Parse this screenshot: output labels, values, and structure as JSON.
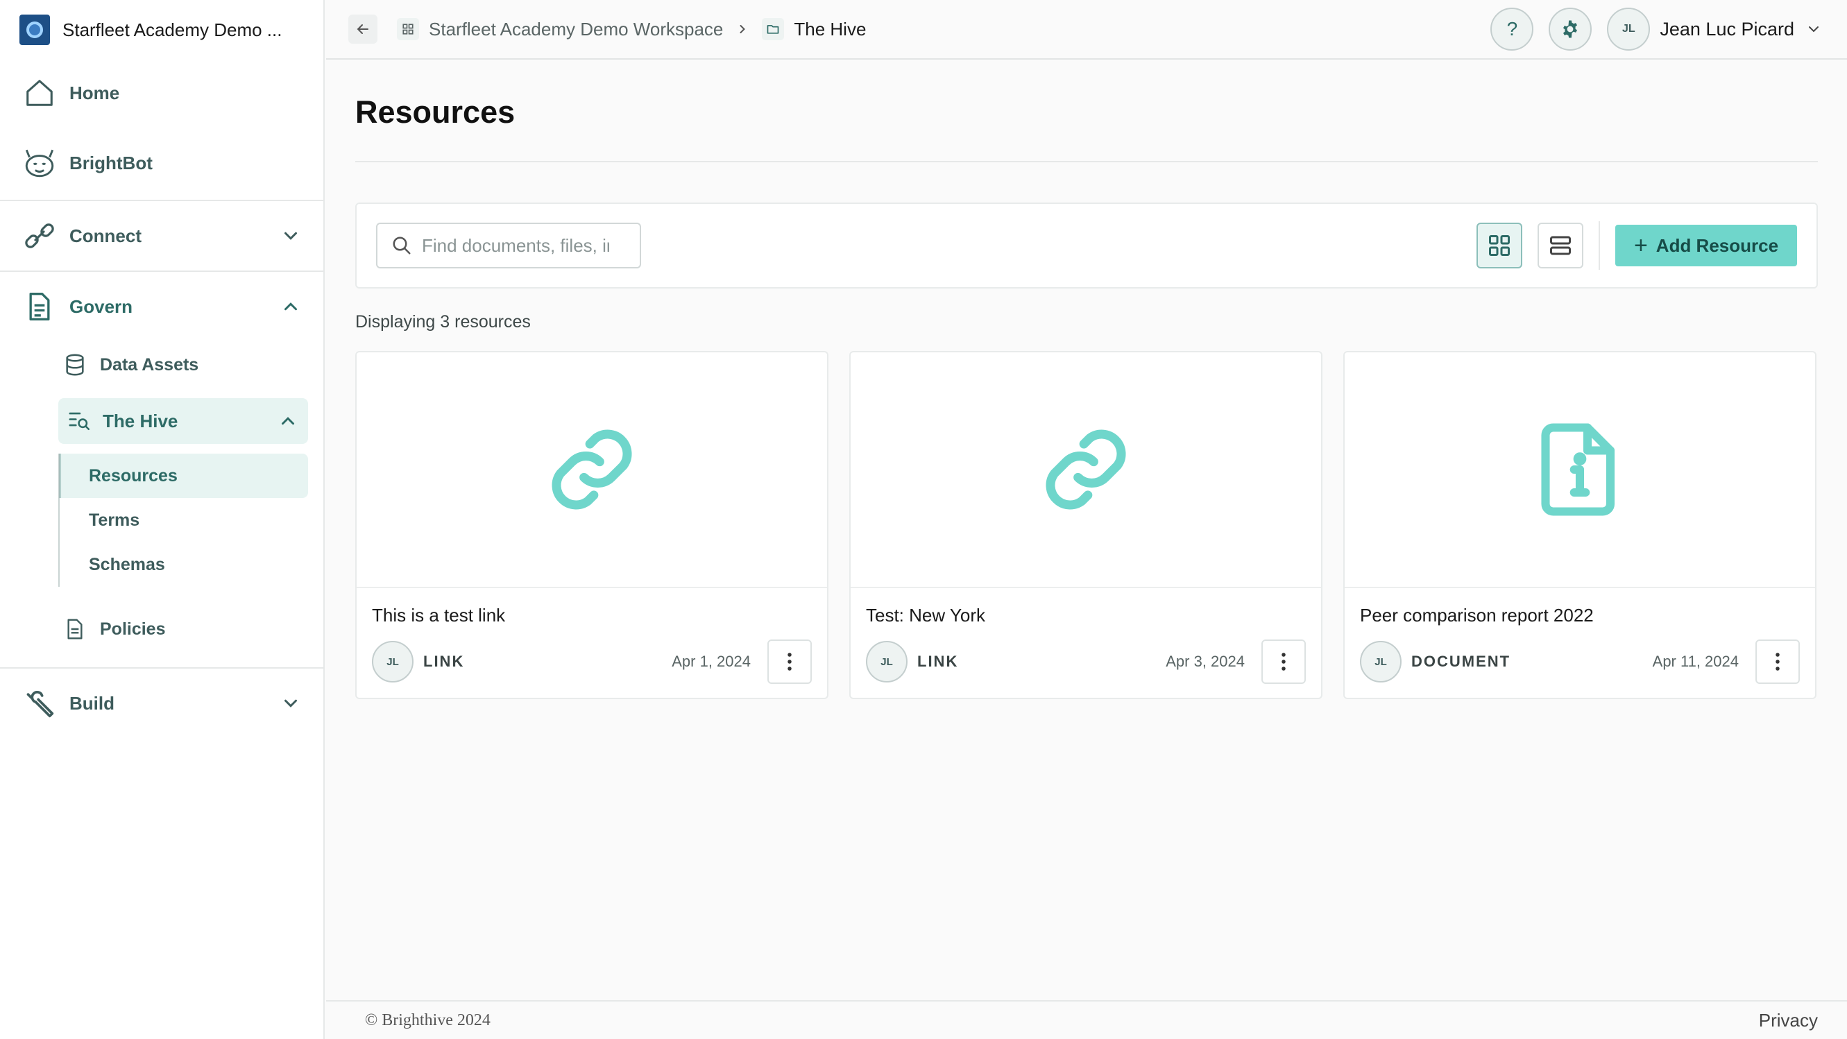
{
  "workspace": {
    "name": "Starfleet Academy Demo ..."
  },
  "sidebar": {
    "home": "Home",
    "brightbot": "BrightBot",
    "connect": "Connect",
    "govern": "Govern",
    "data_assets": "Data Assets",
    "the_hive": "The Hive",
    "hive_children": [
      "Resources",
      "Terms",
      "Schemas"
    ],
    "policies": "Policies",
    "build": "Build"
  },
  "breadcrumb": {
    "workspace": "Starfleet Academy Demo Workspace",
    "current": "The Hive"
  },
  "user": {
    "initials": "JL",
    "name": "Jean Luc Picard"
  },
  "header": {
    "help_symbol": "?"
  },
  "page": {
    "title": "Resources"
  },
  "toolbar": {
    "search_placeholder": "Find documents, files, images...",
    "add_button": "Add Resource",
    "add_symbol": "+"
  },
  "results": {
    "count_text": "Displaying 3 resources"
  },
  "resources": [
    {
      "title": "This is a test link",
      "type": "LINK",
      "date": "Apr 1, 2024",
      "initials": "JL",
      "icon": "link-icon"
    },
    {
      "title": "Test: New York",
      "type": "LINK",
      "date": "Apr 3, 2024",
      "initials": "JL",
      "icon": "link-icon"
    },
    {
      "title": "Peer comparison report 2022",
      "type": "DOCUMENT",
      "date": "Apr 11, 2024",
      "initials": "JL",
      "icon": "document-info-icon"
    }
  ],
  "footer": {
    "copyright": "© Brighthive 2024",
    "privacy": "Privacy"
  },
  "colors": {
    "accent": "#6fd6cb",
    "accent_dark": "#2d6b66",
    "icon_teal": "#6fd6cb"
  }
}
